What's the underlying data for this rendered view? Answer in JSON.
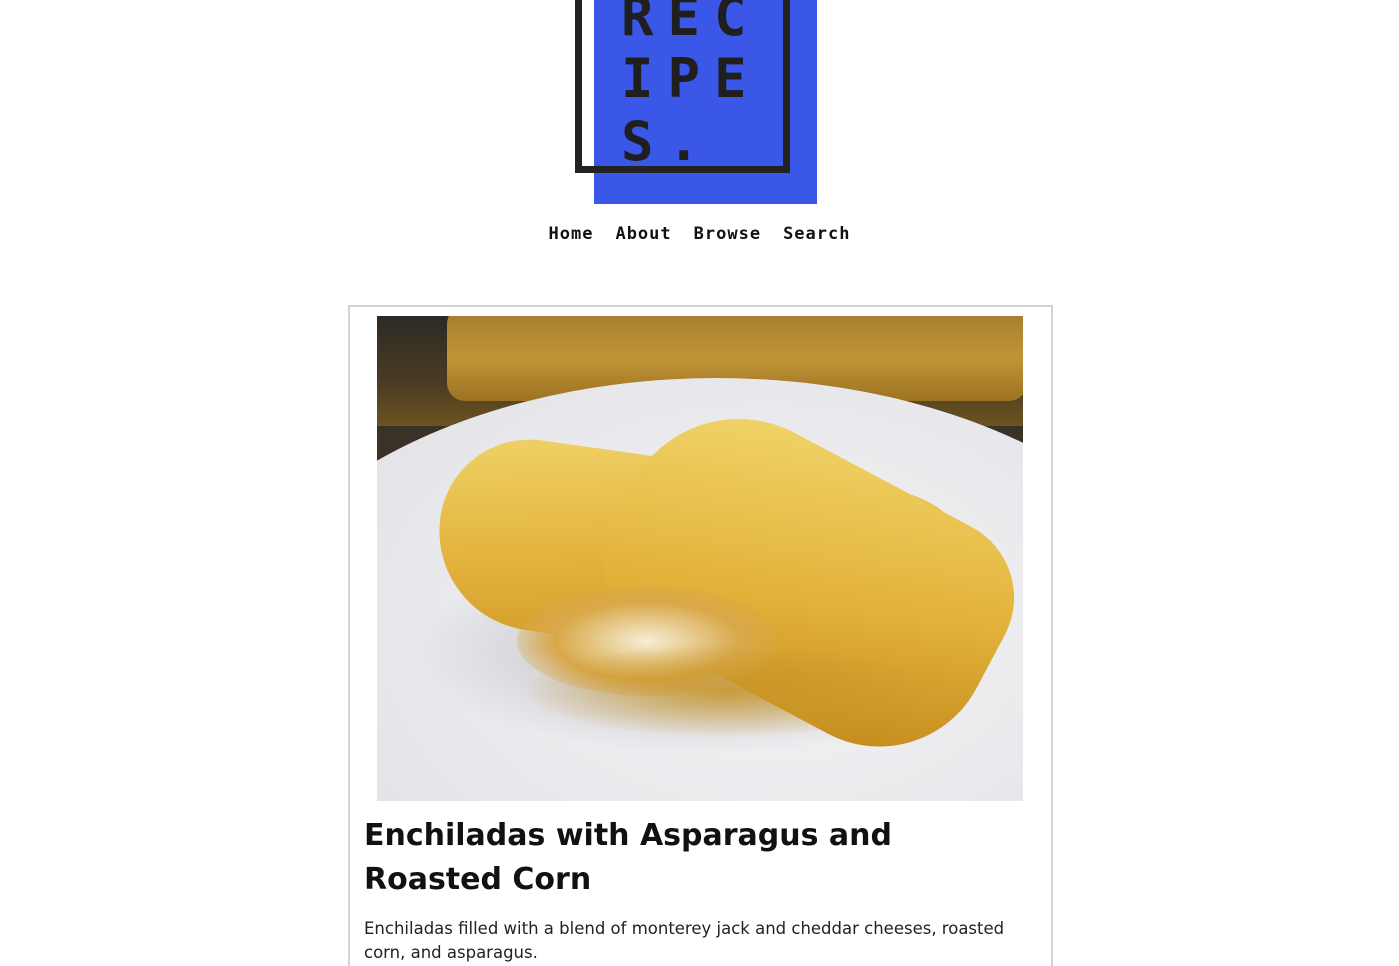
{
  "logo": {
    "lines": [
      "REC",
      "IPE",
      "S."
    ],
    "colors": {
      "block": "#3a57e8",
      "frame": "#222222"
    }
  },
  "nav": {
    "items": [
      {
        "label": "Home"
      },
      {
        "label": "About"
      },
      {
        "label": "Browse"
      },
      {
        "label": "Search"
      }
    ]
  },
  "recipe": {
    "title": "Enchiladas with Asparagus and Roasted Corn",
    "description": "Enchiladas filled with a blend of monterey jack and cheddar cheeses, roasted corn, and asparagus."
  }
}
